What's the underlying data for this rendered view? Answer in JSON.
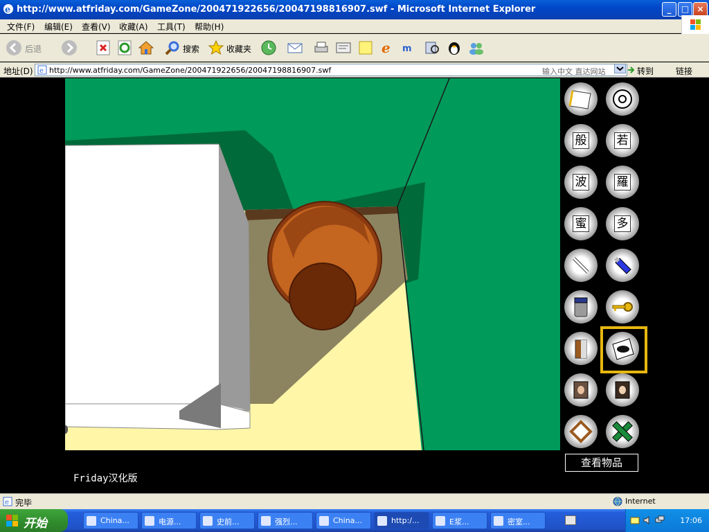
{
  "window": {
    "title": "http://www.atfriday.com/GameZone/200471922656/20047198816907.swf - Microsoft Internet Explorer",
    "minimize": "_",
    "maximize": "□",
    "close": "×"
  },
  "menu": [
    "文件(F)",
    "编辑(E)",
    "查看(V)",
    "收藏(A)",
    "工具(T)",
    "帮助(H)"
  ],
  "toolbar": {
    "back_label": "后退",
    "search_label": "搜索",
    "favorites_label": "收藏夹"
  },
  "address": {
    "label": "地址(D)",
    "url": "http://www.atfriday.com/GameZone/200471922656/20047198816907.swf",
    "hint": "输入中文 直达网站",
    "go_label": "转到",
    "links_label": "链接"
  },
  "game": {
    "inventory_chars": [
      "般",
      "若",
      "波",
      "羅",
      "蜜",
      "多"
    ],
    "view_items_label": "查看物品",
    "credit": "Friday汉化版",
    "colors": {
      "wall": "#009a5a",
      "wall_shadow": "#006a3a",
      "floor": "#fff6a8",
      "floor_shadow": "#8c8460",
      "cabinet": "#ffffff",
      "cabinet_side": "#9a9a9a",
      "pot": "#b4561a",
      "selected": "#e8b70f"
    }
  },
  "status": {
    "text": "完毕",
    "zone": "Internet"
  },
  "taskbar": {
    "start_label": "开始",
    "tasks": [
      "China...",
      "电源...",
      "史前...",
      "强烈...",
      "China...",
      "http:/...",
      "E浆...",
      "密室..."
    ],
    "active_index": 5,
    "clock": "17:06"
  }
}
